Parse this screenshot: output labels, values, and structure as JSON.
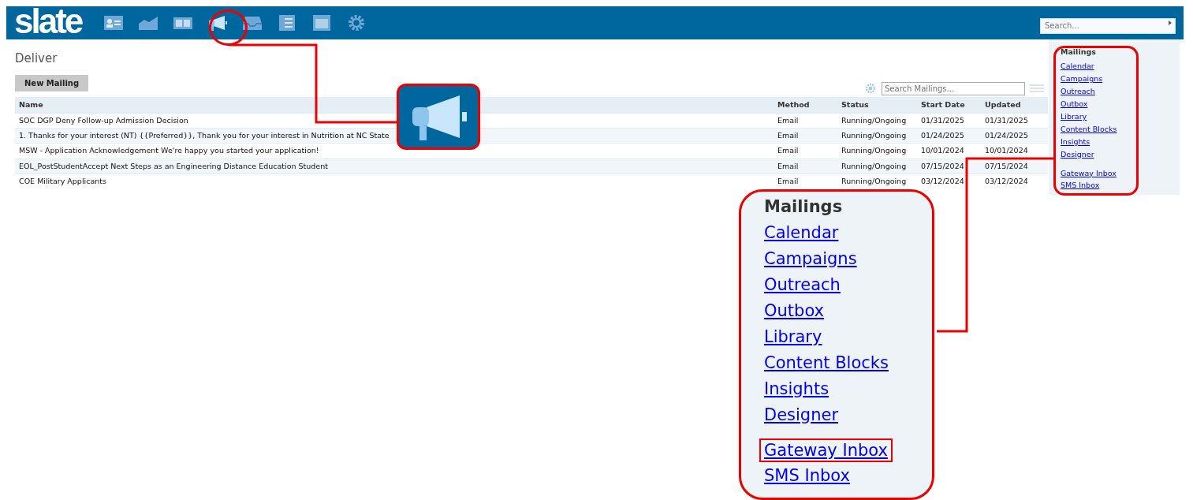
{
  "header": {
    "logo": "slate",
    "search": {
      "placeholder": "Search..."
    },
    "nav_icons": [
      {
        "kind": "card",
        "selected": false
      },
      {
        "kind": "chart",
        "selected": false
      },
      {
        "kind": "book",
        "selected": false
      },
      {
        "kind": "megaphone",
        "selected": true
      },
      {
        "kind": "inbox",
        "selected": false
      },
      {
        "kind": "list",
        "selected": false
      },
      {
        "kind": "calendar",
        "selected": false
      },
      {
        "kind": "gear",
        "selected": false
      }
    ]
  },
  "page_title": "Deliver",
  "new_button": "New Mailing",
  "search_mailings": {
    "placeholder": "Search Mailings..."
  },
  "table": {
    "columns": [
      "Name",
      "Method",
      "Status",
      "Start Date",
      "Updated"
    ],
    "rows": [
      [
        "SOC DGP Deny Follow-up Admission Decision",
        "Email",
        "Running/Ongoing",
        "01/31/2025",
        "01/31/2025"
      ],
      [
        "1. Thanks for your interest (NT) {{Preferred}}, Thank you for your interest in Nutrition at NC State",
        "Email",
        "Running/Ongoing",
        "01/24/2025",
        "01/24/2025"
      ],
      [
        "MSW - Application Acknowledgement We're happy you started your application!",
        "Email",
        "Running/Ongoing",
        "10/01/2024",
        "10/01/2024"
      ],
      [
        "EOL_PostStudentAccept Next Steps as an Engineering Distance Education Student",
        "Email",
        "Running/Ongoing",
        "07/15/2024",
        "07/15/2024"
      ],
      [
        "COE Military Applicants",
        "Email",
        "Running/Ongoing",
        "03/12/2024",
        "03/12/2024"
      ]
    ]
  },
  "sidebar": {
    "title": "Mailings",
    "groups": [
      [
        "Calendar",
        "Campaigns",
        "Outreach",
        "Outbox",
        "Library",
        "Content Blocks",
        "Insights",
        "Designer"
      ],
      [
        "Gateway Inbox",
        "SMS Inbox"
      ]
    ]
  },
  "callout_zoom": {
    "title": "Mailings",
    "groups": [
      [
        {
          "label": "Calendar",
          "highlighted": false
        },
        {
          "label": "Campaigns",
          "highlighted": false
        },
        {
          "label": "Outreach",
          "highlighted": false
        },
        {
          "label": "Outbox",
          "highlighted": false
        },
        {
          "label": "Library",
          "highlighted": false
        },
        {
          "label": "Content Blocks",
          "highlighted": false
        },
        {
          "label": "Insights",
          "highlighted": false
        },
        {
          "label": "Designer",
          "highlighted": false
        }
      ],
      [
        {
          "label": "Gateway Inbox",
          "highlighted": true
        },
        {
          "label": "SMS Inbox",
          "highlighted": false
        }
      ]
    ]
  }
}
